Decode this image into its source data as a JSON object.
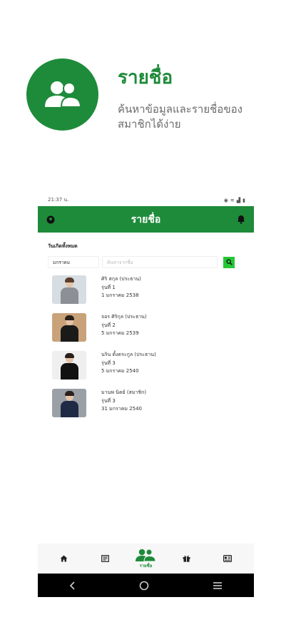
{
  "hero": {
    "title": "รายชื่อ",
    "subtitle": "ค้นหาข้อมูลและรายชื่อของสมาชิกได้ง่าย",
    "icon": "users-icon"
  },
  "status": {
    "time": "21:37 น."
  },
  "appbar": {
    "title": "รายชื่อ"
  },
  "filter": {
    "label": "วันเกิดทั้งหมด",
    "month_value": "มกราคม",
    "search_placeholder": "ค้นหาจากชื่อ"
  },
  "members": [
    {
      "name": "ศิริ สกุล (ประธาน)",
      "gen": "รุ่นที่ 1",
      "date": "1 มกราคม 2538"
    },
    {
      "name": "จอร ศิริกุล (ประธาน)",
      "gen": "รุ่นที่ 2",
      "date": "5 มกราคม 2539"
    },
    {
      "name": "นริน ตั้งตระกูล (ประธาน)",
      "gen": "รุ่นที่ 3",
      "date": "5 มกราคม 2540"
    },
    {
      "name": "มานพ นิตย์ (สมาชิก)",
      "gen": "รุ่นที่ 3",
      "date": "31 มกราคม 2540"
    }
  ],
  "nav": {
    "active_label": "รายชื่อ"
  },
  "colors": {
    "brand": "#1e8b3a",
    "search_button": "#25c736"
  }
}
